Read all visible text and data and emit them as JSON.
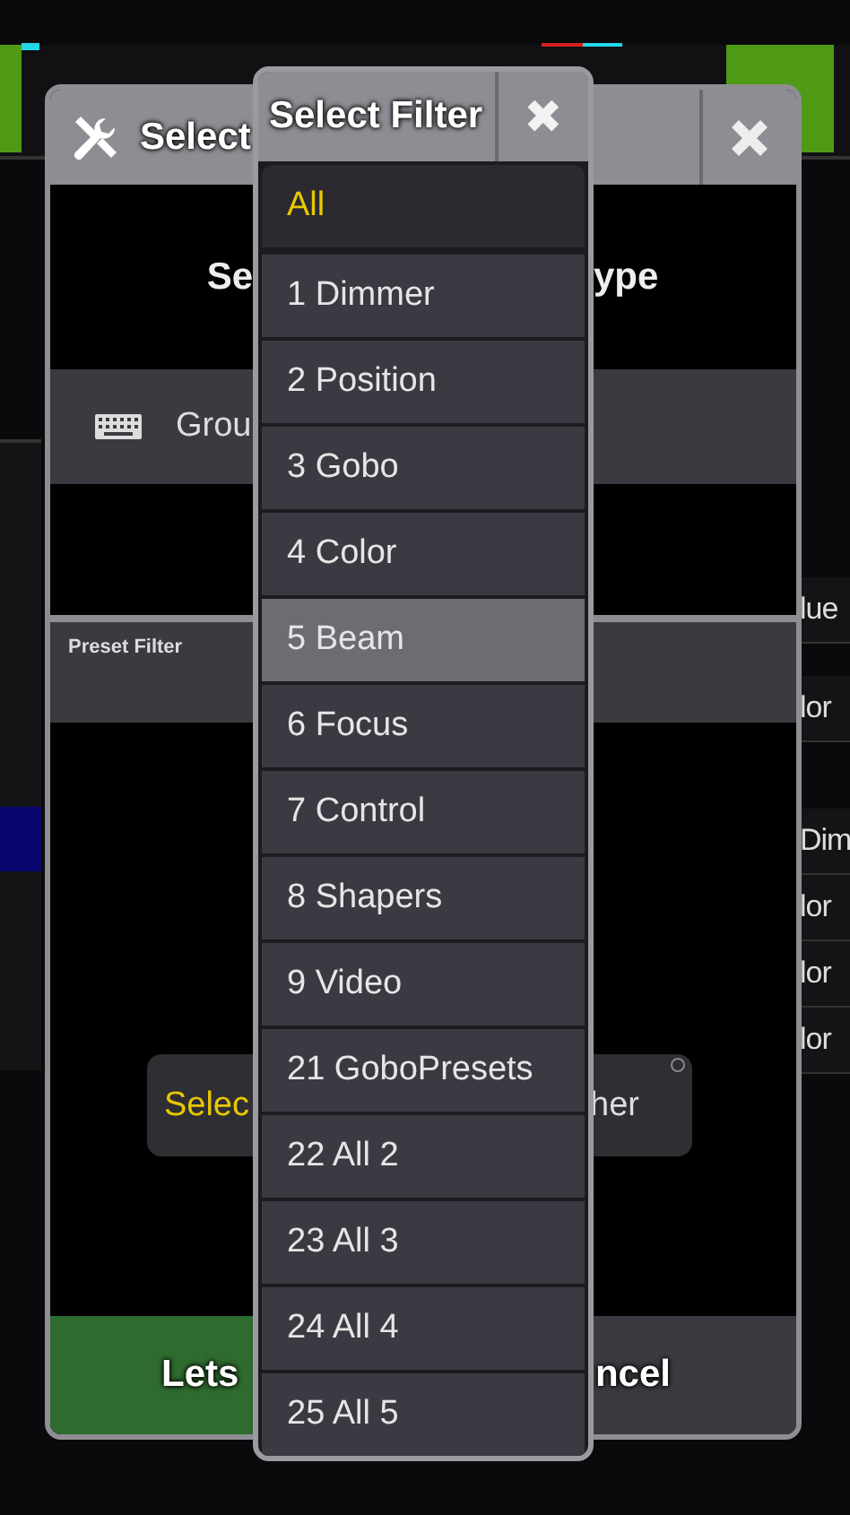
{
  "background": {
    "side_labels": [
      "lue",
      "lor",
      "Dim",
      "lor",
      "lor",
      "lor"
    ]
  },
  "dialog": {
    "title": "Select",
    "heading_left": "Se",
    "heading_right": "ype",
    "input_label": "Grou",
    "preset_filter_label": "Preset Filter",
    "select_button": {
      "left": "Selec",
      "right": "her"
    },
    "ok_button": "Lets",
    "cancel_button": "ncel"
  },
  "popup": {
    "title": "Select Filter",
    "close": "✖",
    "items": [
      {
        "label": "All",
        "selected": true,
        "highlighted": false
      },
      {
        "label": "1 Dimmer",
        "selected": false,
        "highlighted": false
      },
      {
        "label": "2 Position",
        "selected": false,
        "highlighted": false
      },
      {
        "label": "3 Gobo",
        "selected": false,
        "highlighted": false
      },
      {
        "label": "4 Color",
        "selected": false,
        "highlighted": false
      },
      {
        "label": "5 Beam",
        "selected": false,
        "highlighted": true
      },
      {
        "label": "6 Focus",
        "selected": false,
        "highlighted": false
      },
      {
        "label": "7 Control",
        "selected": false,
        "highlighted": false
      },
      {
        "label": "8 Shapers",
        "selected": false,
        "highlighted": false
      },
      {
        "label": "9 Video",
        "selected": false,
        "highlighted": false
      },
      {
        "label": "21 GoboPresets",
        "selected": false,
        "highlighted": false
      },
      {
        "label": "22 All 2",
        "selected": false,
        "highlighted": false
      },
      {
        "label": "23 All 3",
        "selected": false,
        "highlighted": false
      },
      {
        "label": "24 All 4",
        "selected": false,
        "highlighted": false
      },
      {
        "label": "25 All 5",
        "selected": false,
        "highlighted": false
      }
    ]
  }
}
